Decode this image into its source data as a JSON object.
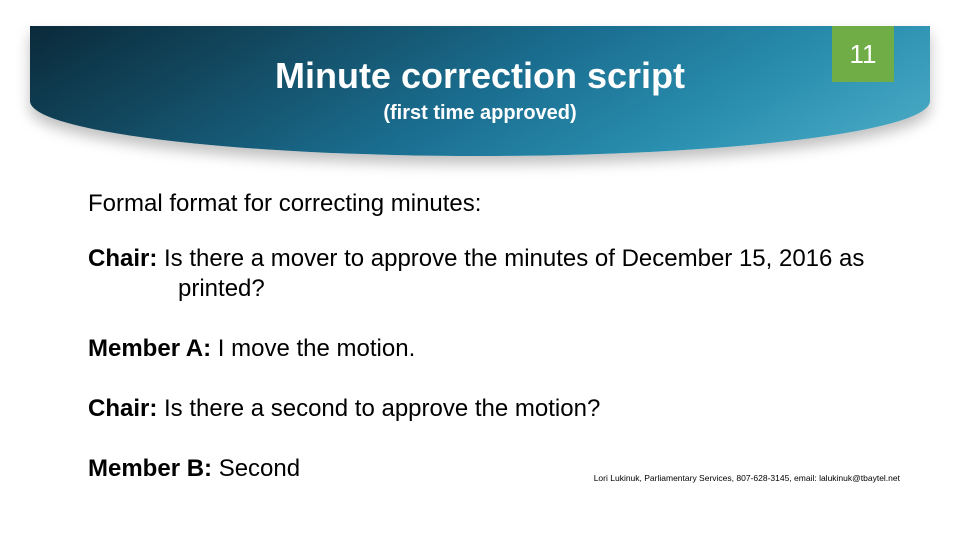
{
  "page_number": "11",
  "title": "Minute correction script",
  "subtitle": "(first time approved)",
  "intro": "Formal format for correcting minutes:",
  "script": [
    {
      "speaker": "Chair:",
      "text": "  Is there a mover to approve the minutes of December 15, 2016 as printed?"
    },
    {
      "speaker": "Member A:",
      "text": "  I move the motion."
    },
    {
      "speaker": "Chair:",
      "text": "  Is there a second to approve the motion?"
    },
    {
      "speaker": "Member B:",
      "text": "  Second"
    }
  ],
  "footer": "Lori Lukinuk, Parliamentary Services, 807-628-3145, email: lalukinuk@tbaytel.net"
}
